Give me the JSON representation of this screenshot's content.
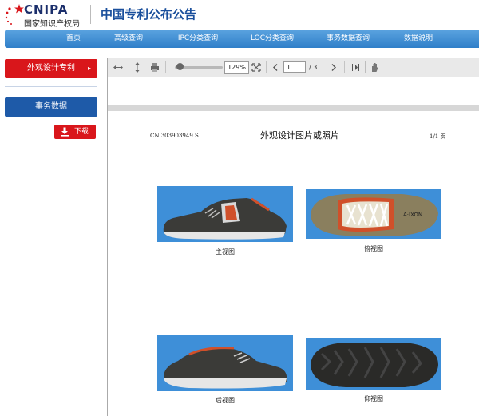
{
  "header": {
    "logo_text": "CNIPA",
    "org_name": "国家知识产权局",
    "site_title": "中国专利公布公告"
  },
  "nav": {
    "items": [
      "首页",
      "高级查询",
      "IPC分类查询",
      "LOC分类查询",
      "事务数据查询",
      "数据说明"
    ]
  },
  "sidebar": {
    "design_patent": "外观设计专利",
    "design_patent_arrow": "▸",
    "transaction_data": "事务数据",
    "download": "下载"
  },
  "viewer": {
    "zoom": "129%",
    "current_page": "1",
    "total_pages": "/ 3"
  },
  "document": {
    "code": "CN 303903949 S",
    "title": "外观设计图片或照片",
    "pages": "1/1 页",
    "captions": [
      "主视图",
      "俯视图",
      "后视图",
      "仰视图"
    ]
  },
  "colors": {
    "nav_blue": "#2f7fc9",
    "red": "#d9161b",
    "dark_blue": "#1e5aa8",
    "photo_background": "#3e8fd8"
  }
}
